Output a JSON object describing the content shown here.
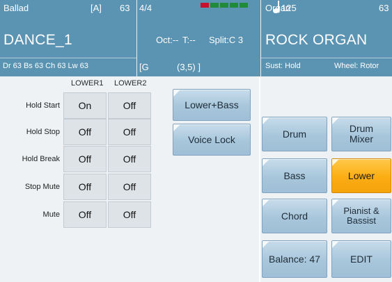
{
  "header": {
    "style_name": "Ballad",
    "variation": "[A]",
    "style_vol": "63",
    "time_sig": "4/4",
    "tempo": "125",
    "song_name": "DANCE_1",
    "oct": "Oct:--",
    "transpose": "T:--",
    "split": "Split:C 3",
    "volumes": "Dr 63  Bs 63  Ch 63  Lw 63",
    "chord_open": "[G",
    "chord_pos": "(3,5) ]",
    "voice_family": "Organ",
    "voice_vol": "63",
    "voice_name": "ROCK ORGAN",
    "sustain": "Sust: Hold",
    "wheel": "Wheel: Rotor"
  },
  "meter_colors": [
    "#c8102e",
    "#1e8a3a",
    "#1e8a3a",
    "#1e8a3a",
    "#1e8a3a"
  ],
  "matrix": {
    "columns": [
      "LOWER1",
      "LOWER2"
    ],
    "rows": [
      {
        "label": "Hold Start",
        "lower1": "On",
        "lower2": "Off"
      },
      {
        "label": "Hold Stop",
        "lower1": "Off",
        "lower2": "Off"
      },
      {
        "label": "Hold Break",
        "lower1": "Off",
        "lower2": "Off"
      },
      {
        "label": "Stop Mute",
        "lower1": "Off",
        "lower2": "Off"
      },
      {
        "label": "Mute",
        "lower1": "Off",
        "lower2": "Off"
      }
    ]
  },
  "buttons": {
    "lower_bass": "Lower+Bass",
    "voice_lock": "Voice Lock",
    "drum": "Drum",
    "drum_mixer": "Drum\nMixer",
    "bass": "Bass",
    "lower": "Lower",
    "chord": "Chord",
    "pianist_bassist": "Pianist &\nBassist",
    "balance": "Balance: 47",
    "edit": "EDIT"
  },
  "colors": {
    "header_bg": "#5b93b3",
    "button_blue": "#a8c6db",
    "button_active": "#fbad12"
  }
}
